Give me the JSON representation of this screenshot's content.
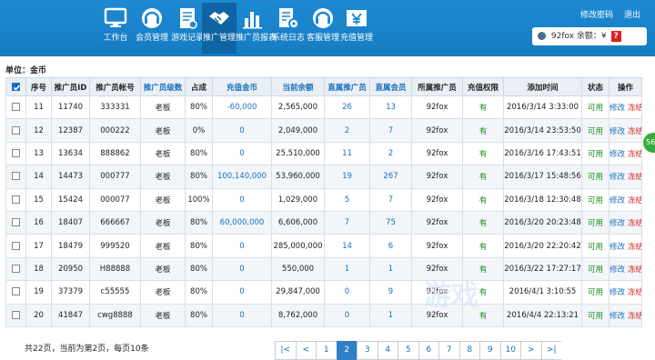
{
  "nav": {
    "items": [
      {
        "label": "工作台",
        "icon": "monitor-icon"
      },
      {
        "label": "会员管理",
        "icon": "member-headset-icon"
      },
      {
        "label": "游戏记录",
        "icon": "game-record-icon"
      },
      {
        "label": "推广管理",
        "icon": "handshake-icon"
      },
      {
        "label": "推广员报表",
        "icon": "bar-chart-icon"
      },
      {
        "label": "系统日志",
        "icon": "log-gear-icon"
      },
      {
        "label": "客服管理",
        "icon": "support-headset-icon"
      },
      {
        "label": "充值管理",
        "icon": "yen-recharge-icon"
      }
    ],
    "active_index": 3,
    "change_password": "修改密码",
    "logout": "退出",
    "user_text": "92fox 余额：¥",
    "help_mark": "?"
  },
  "unit_label": "单位：金币",
  "table": {
    "headers": [
      "",
      "序号",
      "推广员ID",
      "推广员帐号",
      "推广员级数",
      "占成",
      "充值金币",
      "当前余额",
      "直属推广员",
      "直属会员",
      "所属推广员",
      "充值权限",
      "添加时间",
      "状态",
      "操作"
    ],
    "rows": [
      [
        "11",
        "11740",
        "333331",
        "老板",
        "80%",
        "-60,000",
        "2,565,000",
        "26",
        "13",
        "92fox",
        "有",
        "2016/3/14 3:33:00",
        "可用",
        "修改",
        "冻结"
      ],
      [
        "12",
        "12387",
        "000222",
        "老板",
        "0%",
        "0",
        "2,049,000",
        "2",
        "7",
        "92fox",
        "有",
        "2016/3/14 23:53:50",
        "可用",
        "修改",
        "冻结"
      ],
      [
        "13",
        "13634",
        "888862",
        "老板",
        "80%",
        "0",
        "25,510,000",
        "11",
        "2",
        "92fox",
        "有",
        "2016/3/16 17:43:51",
        "可用",
        "修改",
        "冻结"
      ],
      [
        "14",
        "14473",
        "000777",
        "老板",
        "80%",
        "100,140,000",
        "53,960,000",
        "19",
        "267",
        "92fox",
        "有",
        "2016/3/17 15:48:56",
        "可用",
        "修改",
        "冻结"
      ],
      [
        "15",
        "15424",
        "000077",
        "老板",
        "100%",
        "0",
        "1,029,000",
        "5",
        "7",
        "92fox",
        "有",
        "2016/3/18 12:30:48",
        "可用",
        "修改",
        "冻结"
      ],
      [
        "16",
        "18407",
        "666667",
        "老板",
        "80%",
        "60,000,000",
        "6,606,000",
        "7",
        "75",
        "92fox",
        "有",
        "2016/3/20 20:23:48",
        "可用",
        "修改",
        "冻结"
      ],
      [
        "17",
        "18479",
        "999520",
        "老板",
        "80%",
        "0",
        "285,000,000",
        "14",
        "6",
        "92fox",
        "有",
        "2016/3/20 22:20:42",
        "可用",
        "修改",
        "冻结"
      ],
      [
        "18",
        "20950",
        "H88888",
        "老板",
        "80%",
        "0",
        "550,000",
        "1",
        "1",
        "92fox",
        "有",
        "2016/3/22 17:27:17",
        "可用",
        "修改",
        "冻结"
      ],
      [
        "19",
        "37379",
        "c55555",
        "老板",
        "80%",
        "0",
        "29,847,000",
        "0",
        "9",
        "92fox",
        "有",
        "2016/4/1 3:10:55",
        "可用",
        "修改",
        "冻结"
      ],
      [
        "20",
        "41847",
        "cwg8888",
        "老板",
        "80%",
        "0",
        "8,762,000",
        "0",
        "1",
        "92fox",
        "有",
        "2016/4/4 22:13:21",
        "可用",
        "修改",
        "冻结"
      ]
    ]
  },
  "footer_text": "共22页，当前为第2页，每页10条",
  "pager": {
    "items": [
      "|<",
      "<",
      "1",
      "2",
      "3",
      "4",
      "5",
      "6",
      "7",
      "8",
      "9",
      "10",
      ">",
      ">|"
    ],
    "current": "2"
  },
  "side_button": "56",
  "watermark": "游戏"
}
